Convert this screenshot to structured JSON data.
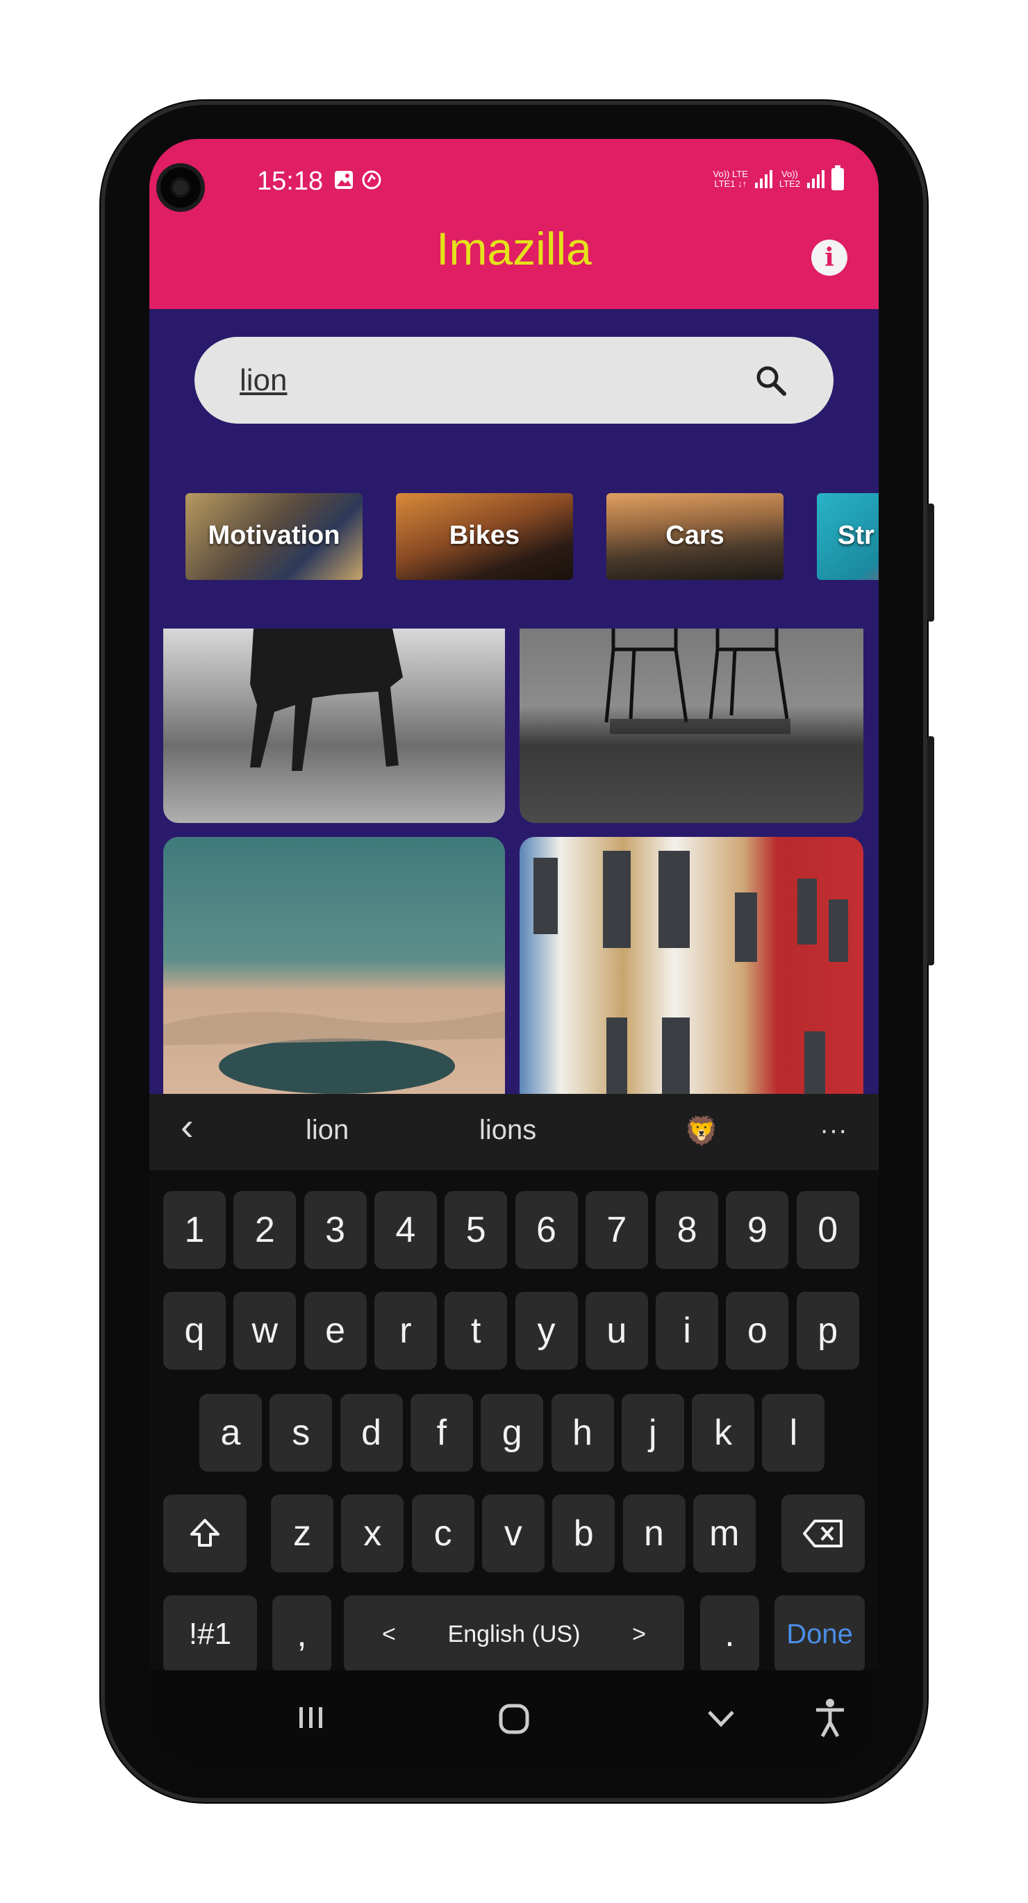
{
  "status_bar": {
    "time": "15:18",
    "net1_top": "Vo)) LTE",
    "net1_bot": "LTE1 ↓↑",
    "net2_top": "Vo))",
    "net2_bot": "LTE2"
  },
  "app": {
    "title": "Imazilla",
    "info_glyph": "i",
    "header_color": "#e01e63",
    "title_color": "#e4e21a",
    "content_bg": "#2a1a6b"
  },
  "search": {
    "value": "lion",
    "icon": "search-icon"
  },
  "categories": [
    {
      "label": "Motivation"
    },
    {
      "label": "Bikes"
    },
    {
      "label": "Cars"
    },
    {
      "label": "Str"
    }
  ],
  "keyboard": {
    "suggestions": [
      "lion",
      "lions",
      "🦁"
    ],
    "back_glyph": "‹",
    "more_glyph": "···",
    "row_numbers": [
      "1",
      "2",
      "3",
      "4",
      "5",
      "6",
      "7",
      "8",
      "9",
      "0"
    ],
    "row1": [
      "q",
      "w",
      "e",
      "r",
      "t",
      "y",
      "u",
      "i",
      "o",
      "p"
    ],
    "row2": [
      "a",
      "s",
      "d",
      "f",
      "g",
      "h",
      "j",
      "k",
      "l"
    ],
    "row3": [
      "z",
      "x",
      "c",
      "v",
      "b",
      "n",
      "m"
    ],
    "symbols_label": "!#1",
    "comma_label": ",",
    "language_label": "English (US)",
    "lang_prev": "<",
    "lang_next": ">",
    "period_label": ".",
    "done_label": "Done"
  }
}
